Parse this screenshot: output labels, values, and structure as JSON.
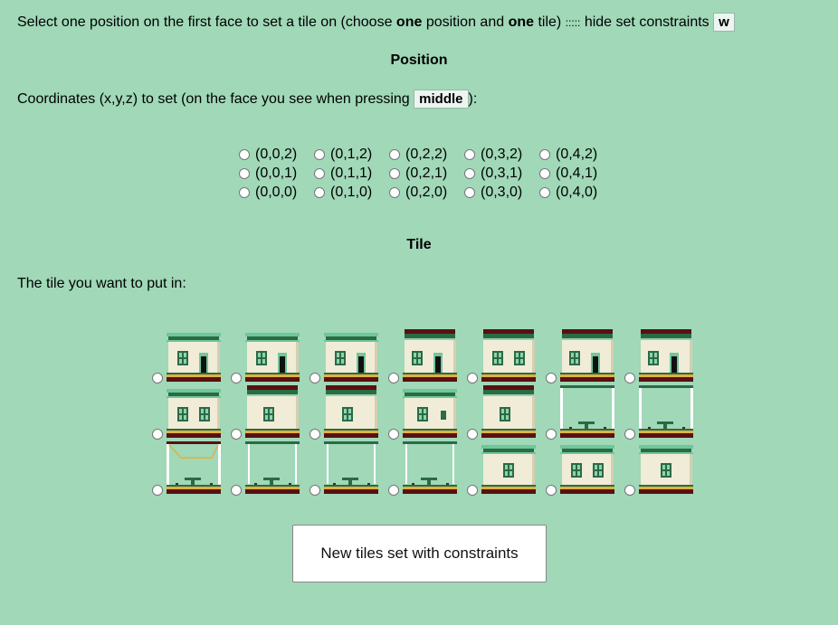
{
  "header": {
    "part1": "Select one position on the first face to set a tile on (choose ",
    "bold1": "one",
    "part2": " position and ",
    "bold2": "one",
    "part3": " tile)",
    "separator": ":::::",
    "hide_label": "hide set constraints",
    "hide_key": "w"
  },
  "position": {
    "title": "Position",
    "instruction_prefix": "Coordinates (x,y,z) to set (on the face you see when pressing ",
    "instruction_key": "middle",
    "instruction_suffix": "):",
    "rows": [
      [
        "(0,0,2)",
        "(0,1,2)",
        "(0,2,2)",
        "(0,3,2)",
        "(0,4,2)"
      ],
      [
        "(0,0,1)",
        "(0,1,1)",
        "(0,2,1)",
        "(0,3,1)",
        "(0,4,1)"
      ],
      [
        "(0,0,0)",
        "(0,1,0)",
        "(0,2,0)",
        "(0,3,0)",
        "(0,4,0)"
      ]
    ]
  },
  "tile": {
    "title": "Tile",
    "instruction": "The tile you want to put in:",
    "rows": [
      [
        "house-top-door-icon",
        "house-top-door-icon",
        "house-top-door-icon",
        "house-dark-roof-door-icon",
        "house-dark-roof-windows-icon",
        "house-dark-roof-door-icon",
        "house-dark-roof-door-icon"
      ],
      [
        "house-middle-windows-icon",
        "house-middle-window-icon",
        "house-middle-window-icon",
        "house-middle-window-small-icon",
        "house-middle-window-icon",
        "frame-table-icon",
        "frame-table-icon"
      ],
      [
        "frame-gold-table-icon",
        "frame-empty-table-icon",
        "frame-empty-table-icon",
        "frame-empty-table-icon",
        "house-green-roof-window-icon",
        "house-green-roof-windows-icon",
        "house-green-roof-window-icon"
      ]
    ]
  },
  "buttons": {
    "new_tiles": "New tiles set with constraints"
  },
  "colors": {
    "background": "#a0d8b8",
    "wall": "#f0ecd8",
    "green_dark": "#2a6b45",
    "green_light": "#6fc79a",
    "brown": "#5a1010",
    "gold": "#e0b040"
  }
}
